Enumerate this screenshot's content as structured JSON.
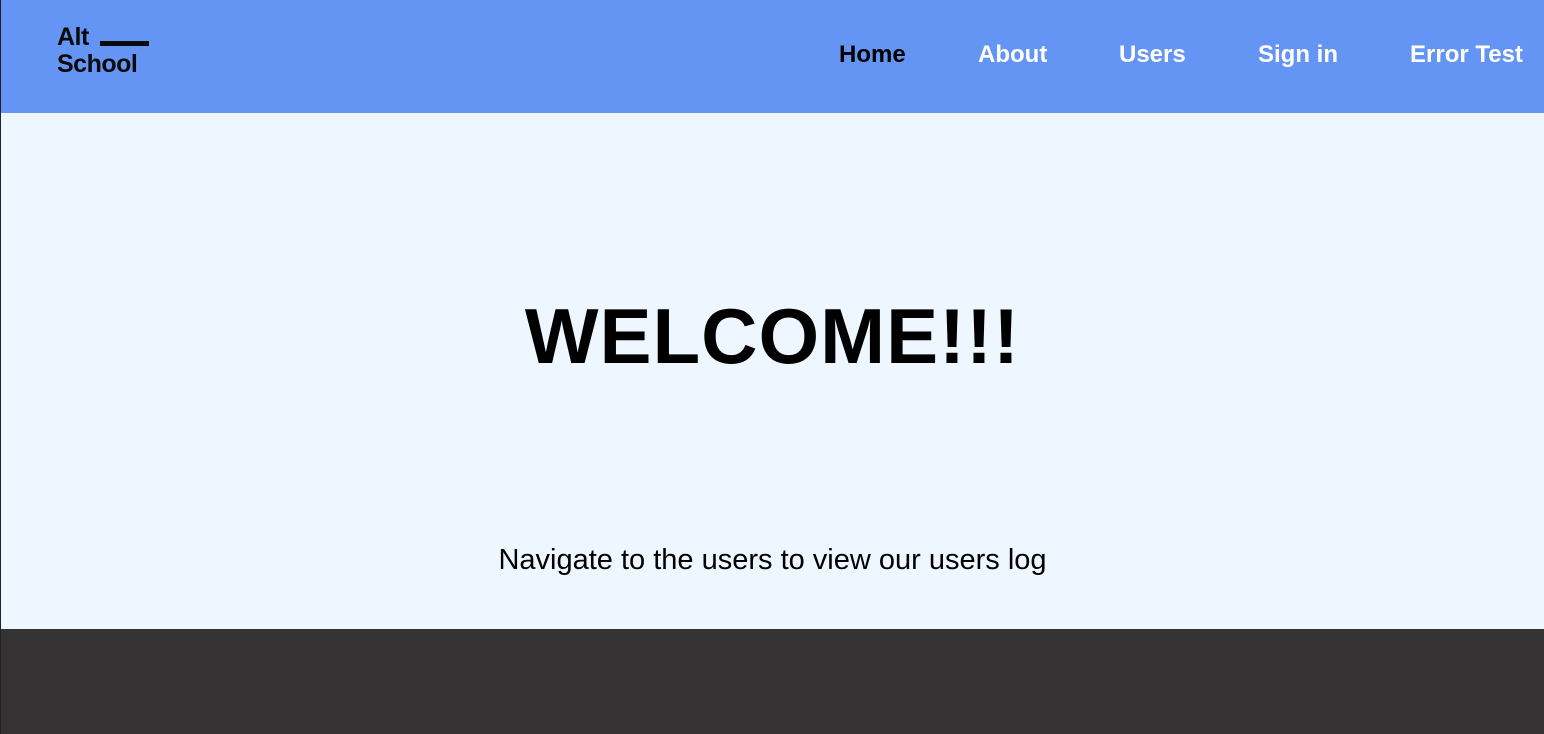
{
  "logo": {
    "line1": "Alt",
    "line2": "School"
  },
  "nav": {
    "items": [
      {
        "label": "Home"
      },
      {
        "label": "About"
      },
      {
        "label": "Users"
      },
      {
        "label": "Sign in"
      },
      {
        "label": "Error Test"
      }
    ]
  },
  "hero": {
    "title": "WELCOME!!!",
    "subtitle": "Navigate to the users to view our users log"
  },
  "colors": {
    "navbar": "#6495f5",
    "page_bg": "#eef7ff",
    "footer": "#343233"
  }
}
